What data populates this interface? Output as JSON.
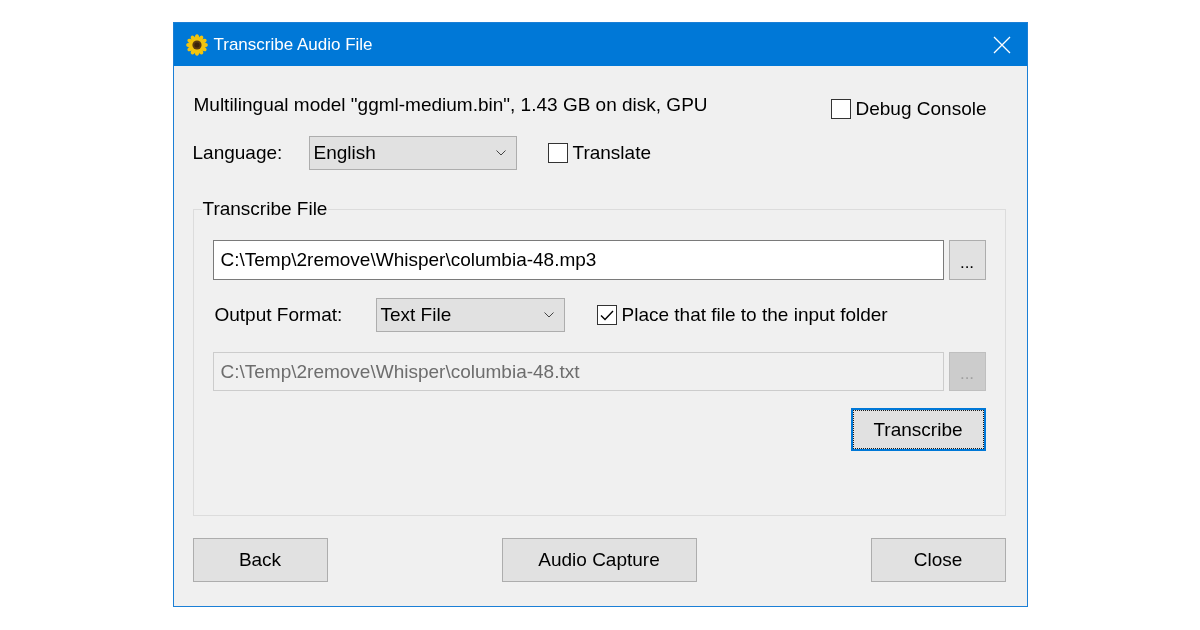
{
  "window": {
    "title": "Transcribe Audio File"
  },
  "model_info": "Multilingual model \"ggml-medium.bin\", 1.43 GB on disk, GPU",
  "debug_console": {
    "label": "Debug Console",
    "checked": false
  },
  "language": {
    "label": "Language:",
    "value": "English"
  },
  "translate": {
    "label": "Translate",
    "checked": false
  },
  "transcribe_file": {
    "title": "Transcribe File",
    "input_path": {
      "value": "C:\\Temp\\2remove\\Whisper\\columbia-48.mp3",
      "disabled": false
    },
    "input_browse": {
      "label": "...",
      "disabled": false
    },
    "output_format": {
      "label": "Output Format:",
      "value": "Text File"
    },
    "place_in_input_folder": {
      "label": "Place that file to the input folder",
      "checked": true
    },
    "output_path": {
      "value": "C:\\Temp\\2remove\\Whisper\\columbia-48.txt",
      "disabled": true
    },
    "output_browse": {
      "label": "...",
      "disabled": true
    },
    "transcribe_button": {
      "label": "Transcribe",
      "focused": true
    }
  },
  "buttons": [
    {
      "label": "Back"
    },
    {
      "label": "Audio Capture"
    },
    {
      "label": "Close"
    }
  ]
}
